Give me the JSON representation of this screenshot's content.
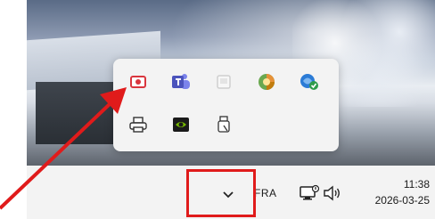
{
  "tray": {
    "overflow_icons": [
      {
        "name": "screen-recorder-icon"
      },
      {
        "name": "teams-icon"
      },
      {
        "name": "blank-window-icon"
      },
      {
        "name": "colorful-app-icon"
      },
      {
        "name": "shield-check-icon"
      },
      {
        "name": "printer-icon"
      },
      {
        "name": "nvidia-icon"
      },
      {
        "name": "usb-drive-icon"
      }
    ]
  },
  "taskbar": {
    "language": "FRA",
    "time": "11:38",
    "date": "2026-03-25"
  },
  "annotation": {
    "highlight_color": "#e01b1b",
    "arrow_color": "#e01b1b"
  },
  "colors": {
    "flyout_bg": "#f3f3f3",
    "taskbar_bg": "#f3f3f3"
  }
}
